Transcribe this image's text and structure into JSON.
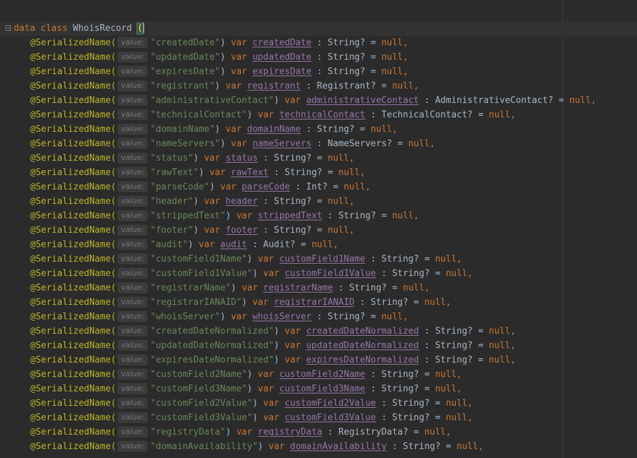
{
  "header": {
    "keyword_data": "data",
    "keyword_class": "class",
    "class_name": "WhoisRecord",
    "open_paren": "("
  },
  "param_hint": "value:",
  "annotation": "@SerializedName(",
  "var_keyword": "var",
  "null_keyword": "null",
  "fields": [
    {
      "key": "\"createdDate\"",
      "name": "createdDate",
      "type": "String?"
    },
    {
      "key": "\"updatedDate\"",
      "name": "updatedDate",
      "type": "String?"
    },
    {
      "key": "\"expiresDate\"",
      "name": "expiresDate",
      "type": "String?"
    },
    {
      "key": "\"registrant\"",
      "name": "registrant",
      "type": "Registrant?"
    },
    {
      "key": "\"administrativeContact\"",
      "name": "administrativeContact",
      "type": "AdministrativeContact?"
    },
    {
      "key": "\"technicalContact\"",
      "name": "technicalContact",
      "type": "TechnicalContact?"
    },
    {
      "key": "\"domainName\"",
      "name": "domainName",
      "type": "String?"
    },
    {
      "key": "\"nameServers\"",
      "name": "nameServers",
      "type": "NameServers?"
    },
    {
      "key": "\"status\"",
      "name": "status",
      "type": "String?"
    },
    {
      "key": "\"rawText\"",
      "name": "rawText",
      "type": "String?"
    },
    {
      "key": "\"parseCode\"",
      "name": "parseCode",
      "type": "Int?"
    },
    {
      "key": "\"header\"",
      "name": "header",
      "type": "String?"
    },
    {
      "key": "\"strippedText\"",
      "name": "strippedText",
      "type": "String?"
    },
    {
      "key": "\"footer\"",
      "name": "footer",
      "type": "String?"
    },
    {
      "key": "\"audit\"",
      "name": "audit",
      "type": "Audit?"
    },
    {
      "key": "\"customField1Name\"",
      "name": "customField1Name",
      "type": "String?"
    },
    {
      "key": "\"customField1Value\"",
      "name": "customField1Value",
      "type": "String?"
    },
    {
      "key": "\"registrarName\"",
      "name": "registrarName",
      "type": "String?"
    },
    {
      "key": "\"registrarIANAID\"",
      "name": "registrarIANAID",
      "type": "String?"
    },
    {
      "key": "\"whoisServer\"",
      "name": "whoisServer",
      "type": "String?"
    },
    {
      "key": "\"createdDateNormalized\"",
      "name": "createdDateNormalized",
      "type": "String?"
    },
    {
      "key": "\"updatedDateNormalized\"",
      "name": "updatedDateNormalized",
      "type": "String?"
    },
    {
      "key": "\"expiresDateNormalized\"",
      "name": "expiresDateNormalized",
      "type": "String?"
    },
    {
      "key": "\"customField2Name\"",
      "name": "customField2Name",
      "type": "String?"
    },
    {
      "key": "\"customField3Name\"",
      "name": "customField3Name",
      "type": "String?"
    },
    {
      "key": "\"customField2Value\"",
      "name": "customField2Value",
      "type": "String?"
    },
    {
      "key": "\"customField3Value\"",
      "name": "customField3Value",
      "type": "String?"
    },
    {
      "key": "\"registryData\"",
      "name": "registryData",
      "type": "RegistryData?"
    },
    {
      "key": "\"domainAvailability\"",
      "name": "domainAvailability",
      "type": "String?"
    }
  ],
  "colors": {
    "background": "#2b2b2b",
    "keyword": "#cc7832",
    "annotation": "#bbb529",
    "string": "#6a8759",
    "property": "#9876aa",
    "text": "#a9b7c6"
  },
  "icons": {
    "gutter": "fold-icon"
  }
}
